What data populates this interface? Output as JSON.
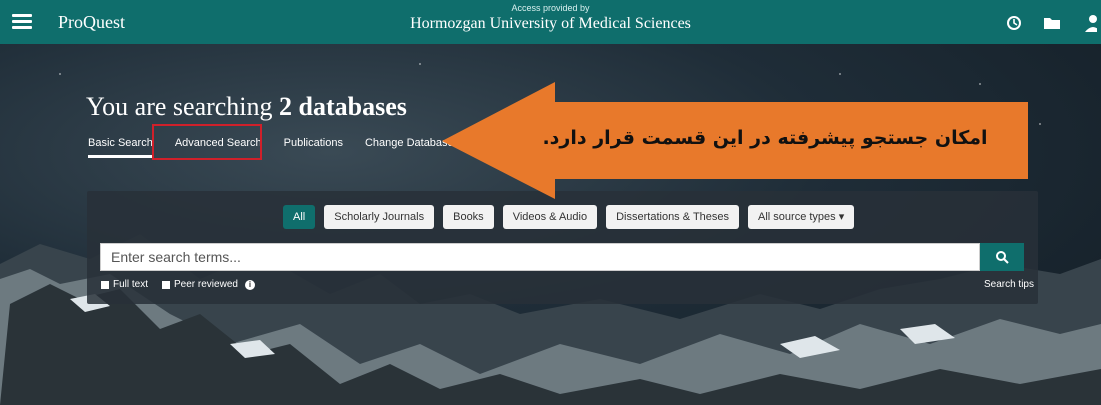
{
  "topbar": {
    "brand": "ProQuest",
    "access_label": "Access provided by",
    "institution": "Hormozgan University of Medical Sciences",
    "icons": [
      "menu-icon",
      "history-icon",
      "folder-icon",
      "user-icon"
    ]
  },
  "hero": {
    "headline_prefix": "You are searching ",
    "headline_bold": "2 databases",
    "tabs": [
      "Basic Search",
      "Advanced Search",
      "Publications",
      "Change Databases"
    ],
    "active_tab": "Basic Search"
  },
  "filters": [
    "All",
    "Scholarly Journals",
    "Books",
    "Videos & Audio",
    "Dissertations & Theses",
    "All source types ▾"
  ],
  "active_filter": "All",
  "search": {
    "placeholder": "Enter search terms...",
    "full_text_label": "Full text",
    "peer_reviewed_label": "Peer reviewed",
    "tips_label": "Search tips"
  },
  "annotation": {
    "text": "امکان جستجو پیشرفته در این قسمت قرار دارد.",
    "arrow_color": "#e8792b",
    "highlight_color": "#d0202a"
  },
  "colors": {
    "brand": "#0f6e6c"
  }
}
